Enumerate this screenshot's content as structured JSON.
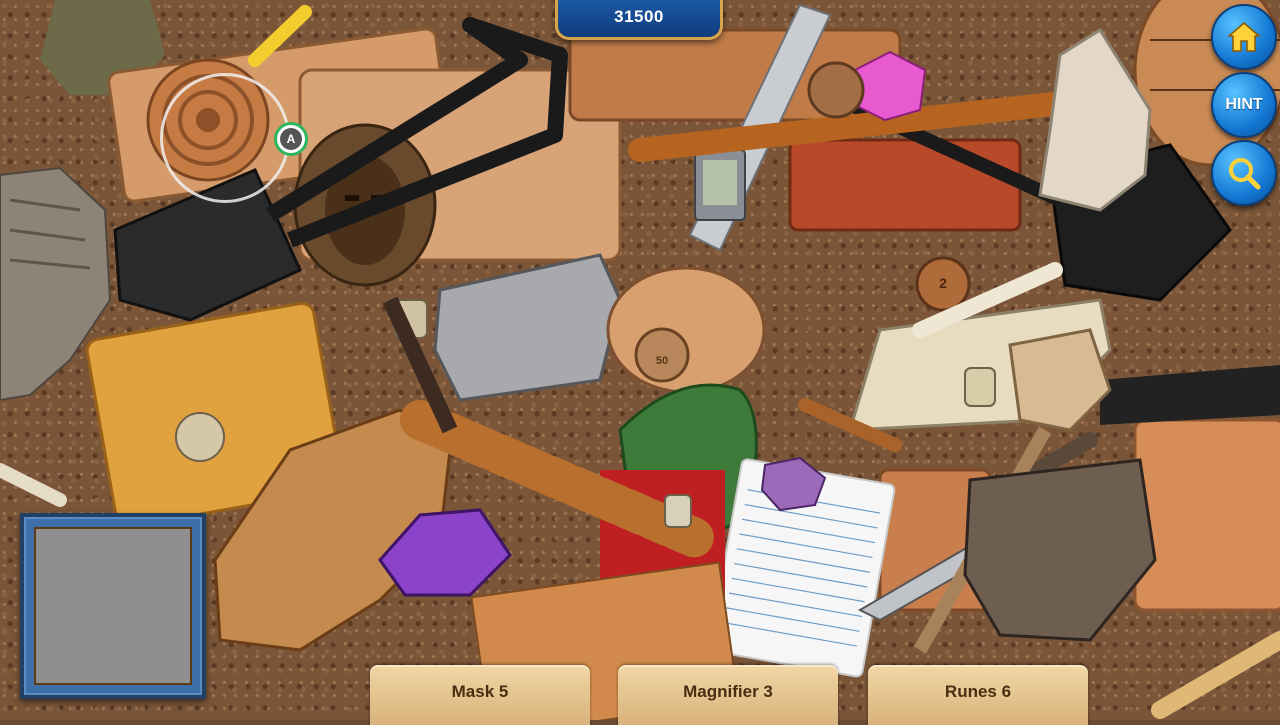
{
  "hud": {
    "score": "31500",
    "buttons": {
      "home": {
        "icon": "home-icon"
      },
      "hint": {
        "label": "HINT"
      },
      "zoom": {
        "icon": "magnifier-icon"
      }
    },
    "magnifier_marker": "A"
  },
  "tasks": [
    {
      "label": "Mask 5"
    },
    {
      "label": "Magnifier 3"
    },
    {
      "label": "Runes 6"
    }
  ],
  "coins": {
    "coin_50": "50",
    "coin_2": "2"
  },
  "colors": {
    "score_bg": "#1a4f99",
    "button_blue": "#1478d4",
    "task_panel": "#e4c38c",
    "frame_blue": "#3f6fa8"
  }
}
